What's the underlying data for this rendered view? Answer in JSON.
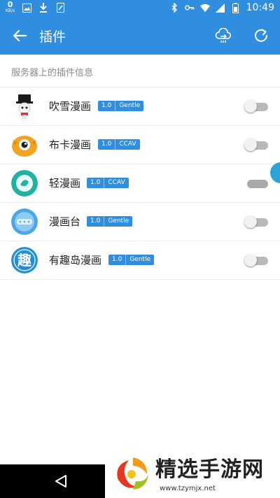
{
  "status_bar": {
    "net_speed": "0",
    "net_unit": "KB/s",
    "time": "10:49",
    "icons": [
      "image-icon",
      "download-icon",
      "file-icon",
      "bluetooth-icon",
      "key-icon",
      "wifi-icon",
      "signal-icon",
      "battery-icon"
    ]
  },
  "app_bar": {
    "title": "插件",
    "back_icon": "arrow-left-icon",
    "actions": [
      "cloud-sync-icon",
      "refresh-icon"
    ]
  },
  "section_header": "服务器上的插件信息",
  "plugins": [
    {
      "name": "吹雪漫画",
      "version": "1.0",
      "tag": "Gentle",
      "enabled": false
    },
    {
      "name": "布卡漫画",
      "version": "1.0",
      "tag": "CCAV",
      "enabled": false
    },
    {
      "name": "轻漫画",
      "version": "1.0",
      "tag": "CCAV",
      "enabled": false
    },
    {
      "name": "漫画台",
      "version": "1.0",
      "tag": "Gentle",
      "enabled": false
    },
    {
      "name": "有趣岛漫画",
      "version": "1.0",
      "tag": "Gentle",
      "enabled": false
    }
  ],
  "colors": {
    "primary": "#2f8ee0",
    "badge": "#2f8ee0",
    "toggle_off": "#b9b9b9"
  },
  "watermark": {
    "title": "精选手游网",
    "url": "www.tzymjx.net"
  }
}
